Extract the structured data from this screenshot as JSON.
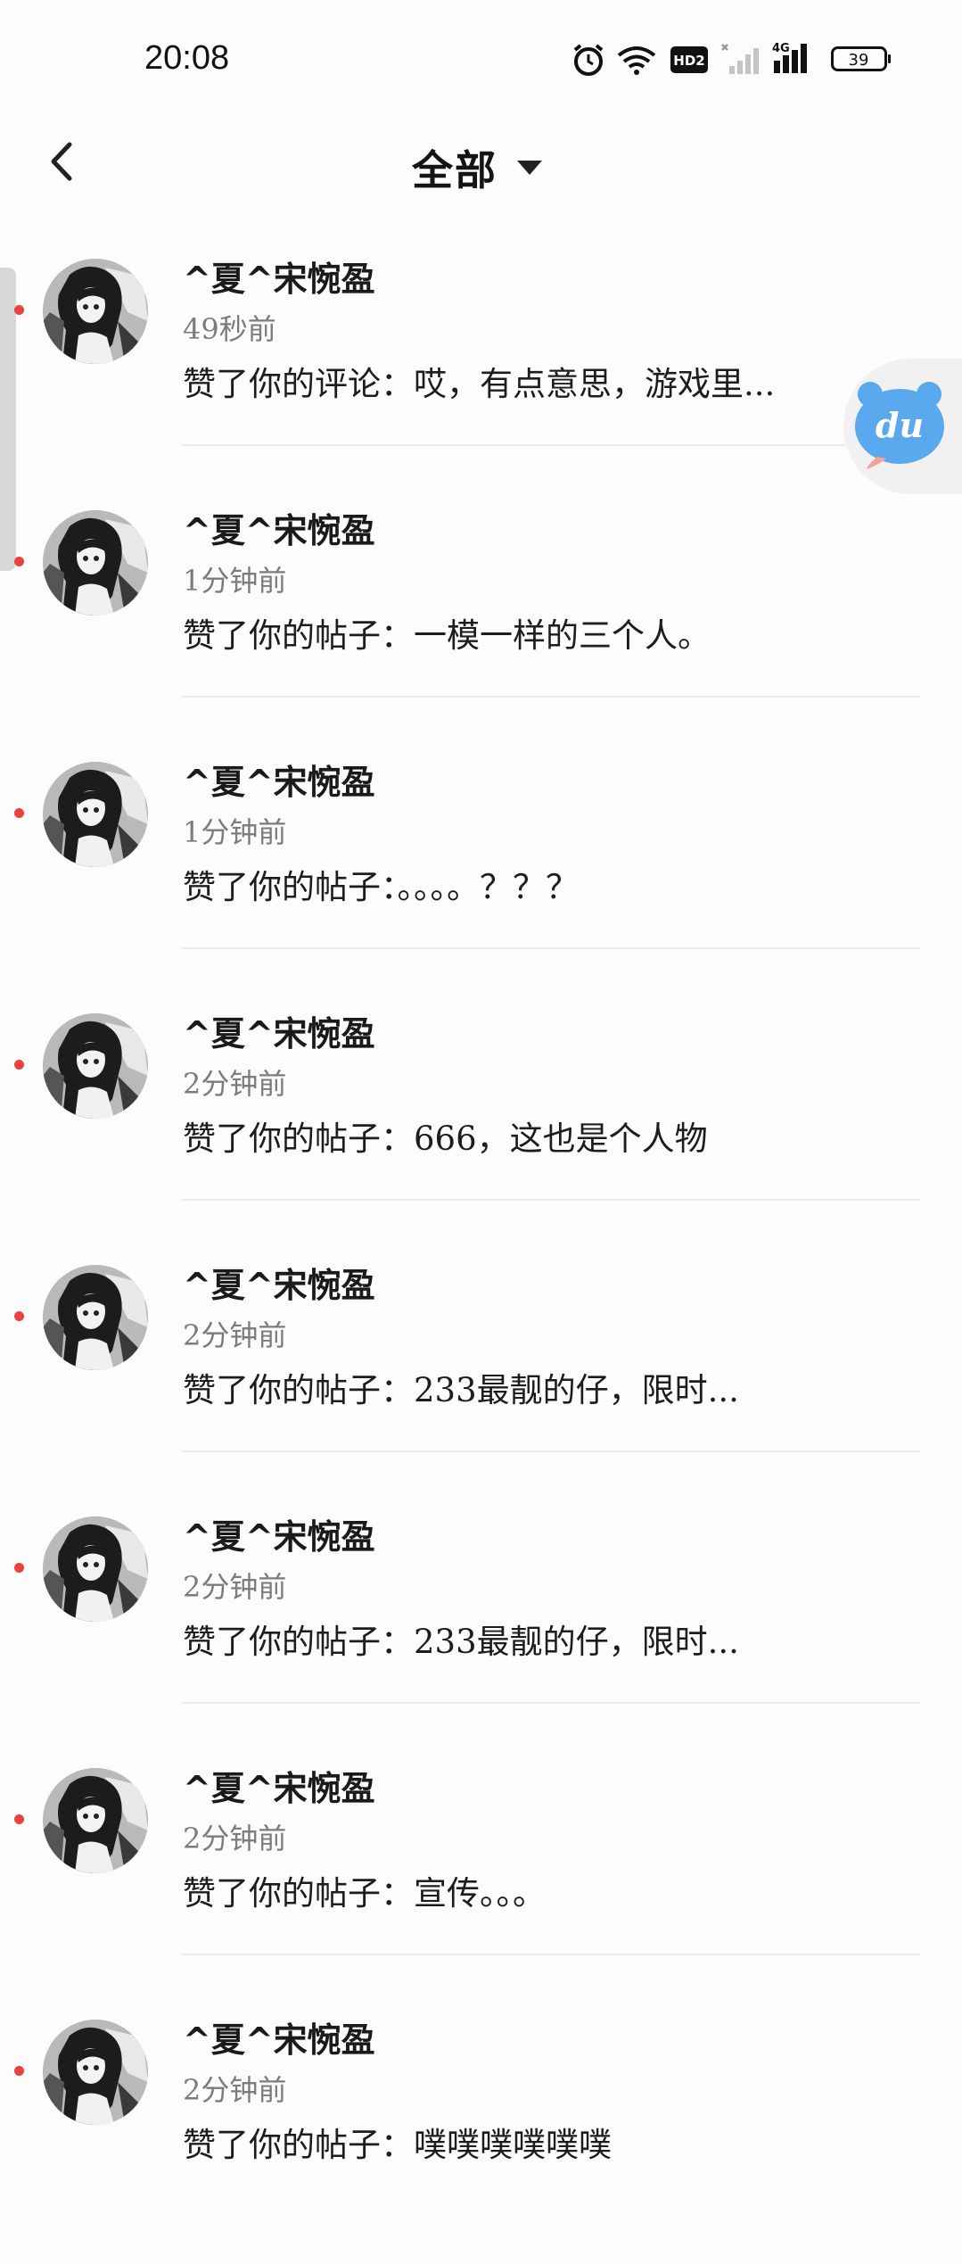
{
  "status_bar": {
    "time": "20:08",
    "battery": "39",
    "hd_label": "HD2",
    "network_label": "4G",
    "icons": [
      "alarm-icon",
      "wifi-icon",
      "hd-icon",
      "signal-icon",
      "signal-4g-icon",
      "battery-icon"
    ]
  },
  "header": {
    "back_icon": "back-arrow-icon",
    "title": "全部",
    "dropdown_icon": "caret-down-icon"
  },
  "floating_widget": {
    "label": "du",
    "icon": "du-bear-icon"
  },
  "notifications": [
    {
      "user": "^夏^宋惋盈",
      "time": "49秒前",
      "message": "赞了你的评论：哎，有点意思，游戏里...",
      "unread": true
    },
    {
      "user": "^夏^宋惋盈",
      "time": "1分钟前",
      "message": "赞了你的帖子：一模一样的三个人。",
      "unread": true
    },
    {
      "user": "^夏^宋惋盈",
      "time": "1分钟前",
      "message": "赞了你的帖子：。。。。？？？",
      "unread": true
    },
    {
      "user": "^夏^宋惋盈",
      "time": "2分钟前",
      "message": "赞了你的帖子：666，这也是个人物",
      "unread": true
    },
    {
      "user": "^夏^宋惋盈",
      "time": "2分钟前",
      "message": "赞了你的帖子：233最靓的仔，限时...",
      "unread": true
    },
    {
      "user": "^夏^宋惋盈",
      "time": "2分钟前",
      "message": "赞了你的帖子：233最靓的仔，限时...",
      "unread": true
    },
    {
      "user": "^夏^宋惋盈",
      "time": "2分钟前",
      "message": "赞了你的帖子：宣传。。。",
      "unread": true
    },
    {
      "user": "^夏^宋惋盈",
      "time": "2分钟前",
      "message": "赞了你的帖子：噗噗噗噗噗噗",
      "unread": true
    }
  ],
  "colors": {
    "unread_dot": "#e8413e",
    "accent_blue": "#5aa9ee",
    "divider": "#ededed"
  }
}
